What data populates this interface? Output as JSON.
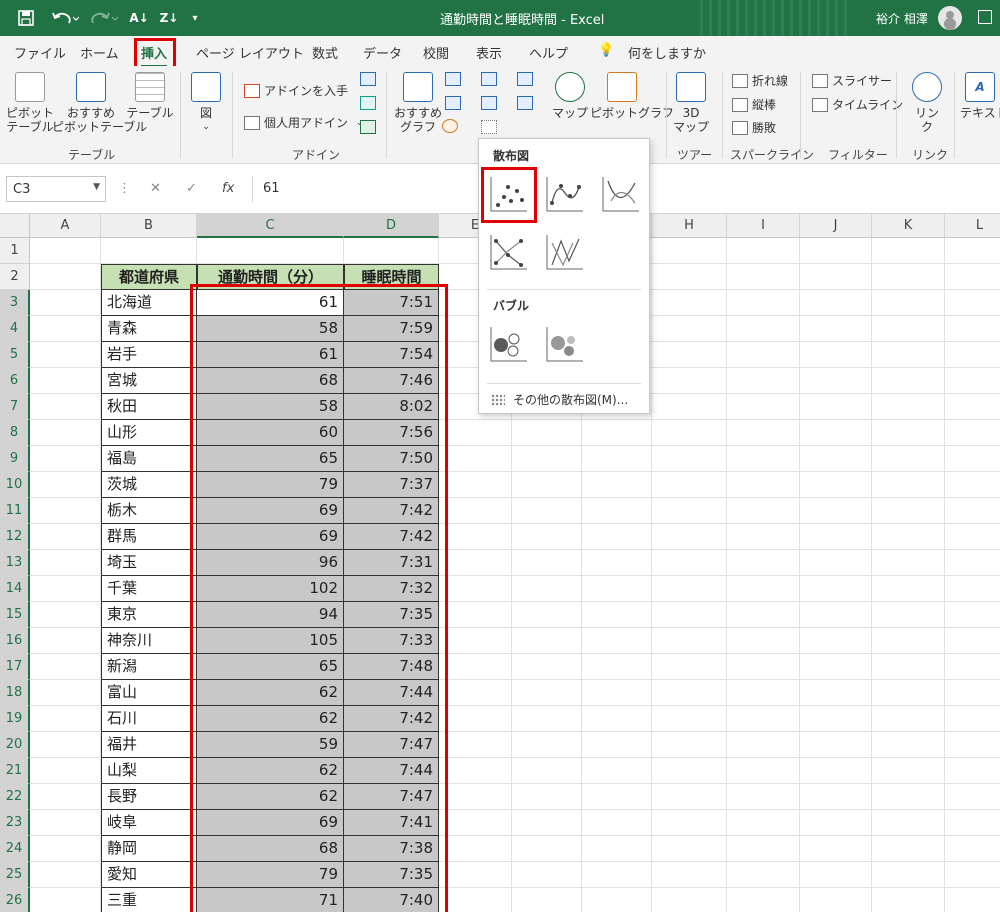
{
  "titlebar": {
    "window_title": "通勤時間と睡眠時間  -  Excel",
    "user_name": "裕介 相澤",
    "icons": [
      "save-icon",
      "undo-icon",
      "redo-icon",
      "sort-ascending-icon",
      "sort-descending-icon",
      "customize-qat-icon"
    ]
  },
  "ribbon_tabs": [
    "ファイル",
    "ホーム",
    "挿入",
    "ページ レイアウト",
    "数式",
    "データ",
    "校閲",
    "表示",
    "ヘルプ"
  ],
  "active_tab": "挿入",
  "tell_me": "何をしますか",
  "ribbon": {
    "pivot_table": "ピボット\nテーブル",
    "recommended_pivot": "おすすめ\nピボットテーブル",
    "table": "テーブル",
    "group_table": "テーブル",
    "illustrations": "図",
    "get_addins": "アドインを入手",
    "my_addins": "個人用アドイン",
    "group_addins": "アドイン",
    "recommended_charts": "おすすめ\nグラフ",
    "maps": "マップ",
    "pivot_chart": "ピボットグラフ",
    "map3d": "3D\nマップ",
    "group_tours": "ツアー",
    "spark_line": "折れ線",
    "spark_column": "縦棒",
    "spark_winloss": "勝敗",
    "group_sparklines": "スパークライン",
    "slicer": "スライサー",
    "timeline": "タイムライン",
    "group_filters": "フィルター",
    "link": "リン\nク",
    "group_links": "リンク",
    "text": "テキスト"
  },
  "formula_bar": {
    "name_box": "C3",
    "fx": "fx",
    "value": "61"
  },
  "columns": [
    "A",
    "B",
    "C",
    "D",
    "E",
    "F",
    "G",
    "H",
    "I",
    "J",
    "K",
    "L"
  ],
  "rows": [
    "1",
    "2",
    "3",
    "4",
    "5",
    "6",
    "7",
    "8",
    "9",
    "10",
    "11",
    "12",
    "13",
    "14",
    "15",
    "16",
    "17",
    "18",
    "19",
    "20",
    "21",
    "22",
    "23",
    "24",
    "25",
    "26"
  ],
  "table_headers": [
    "都道府県",
    "通勤時間（分）",
    "睡眠時間"
  ],
  "table_rows": [
    [
      "北海道",
      "61",
      "7:51"
    ],
    [
      "青森",
      "58",
      "7:59"
    ],
    [
      "岩手",
      "61",
      "7:54"
    ],
    [
      "宮城",
      "68",
      "7:46"
    ],
    [
      "秋田",
      "58",
      "8:02"
    ],
    [
      "山形",
      "60",
      "7:56"
    ],
    [
      "福島",
      "65",
      "7:50"
    ],
    [
      "茨城",
      "79",
      "7:37"
    ],
    [
      "栃木",
      "69",
      "7:42"
    ],
    [
      "群馬",
      "69",
      "7:42"
    ],
    [
      "埼玉",
      "96",
      "7:31"
    ],
    [
      "千葉",
      "102",
      "7:32"
    ],
    [
      "東京",
      "94",
      "7:35"
    ],
    [
      "神奈川",
      "105",
      "7:33"
    ],
    [
      "新潟",
      "65",
      "7:48"
    ],
    [
      "富山",
      "62",
      "7:44"
    ],
    [
      "石川",
      "62",
      "7:42"
    ],
    [
      "福井",
      "59",
      "7:47"
    ],
    [
      "山梨",
      "62",
      "7:44"
    ],
    [
      "長野",
      "62",
      "7:47"
    ],
    [
      "岐阜",
      "69",
      "7:41"
    ],
    [
      "静岡",
      "68",
      "7:38"
    ],
    [
      "愛知",
      "79",
      "7:35"
    ],
    [
      "三重",
      "71",
      "7:40"
    ]
  ],
  "dropdown": {
    "scatter_title": "散布図",
    "bubble_title": "バブル",
    "more_scatter": "その他の散布図(M)..."
  },
  "colors": {
    "excel_green": "#217346",
    "header_fill": "#c6e0b4",
    "selection_fill": "#c8c8c8",
    "highlight_red": "#e00000"
  }
}
